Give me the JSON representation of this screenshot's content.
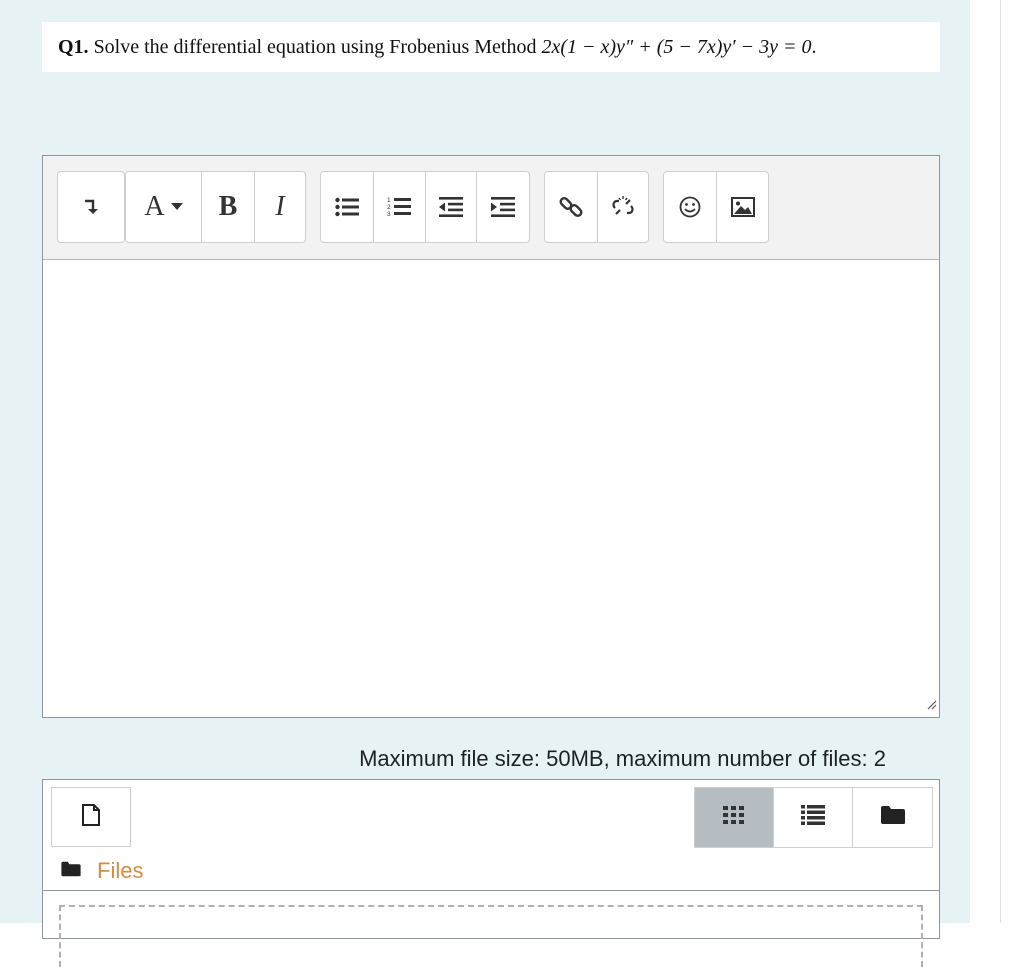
{
  "question": {
    "number": "Q1.",
    "text": " Solve the differential equation using Frobenius Method ",
    "equation": "2x(1 − x)y″ + (5 − 7x)y′ − 3y = 0",
    "period": "."
  },
  "toolbar": {
    "show_more_icon": "arrow-down-hook-icon",
    "text_style_label": "A",
    "bold_label": "B",
    "italic_label": "I",
    "icons": [
      "unordered-list-icon",
      "ordered-list-icon",
      "outdent-icon",
      "indent-icon",
      "link-icon",
      "unlink-icon",
      "emoji-icon",
      "image-icon"
    ]
  },
  "filemanager": {
    "limits_text": "Maximum file size: 50MB, maximum number of files: 2",
    "files_label": "Files",
    "view_icons": [
      "grid-view-icon",
      "list-view-icon",
      "folder-view-icon"
    ],
    "active_view": "grid-view-icon"
  },
  "colors": {
    "panel_bg": "#e7f2f5",
    "files_link": "#d18e3e",
    "active_view_bg": "#b5bdc3"
  }
}
